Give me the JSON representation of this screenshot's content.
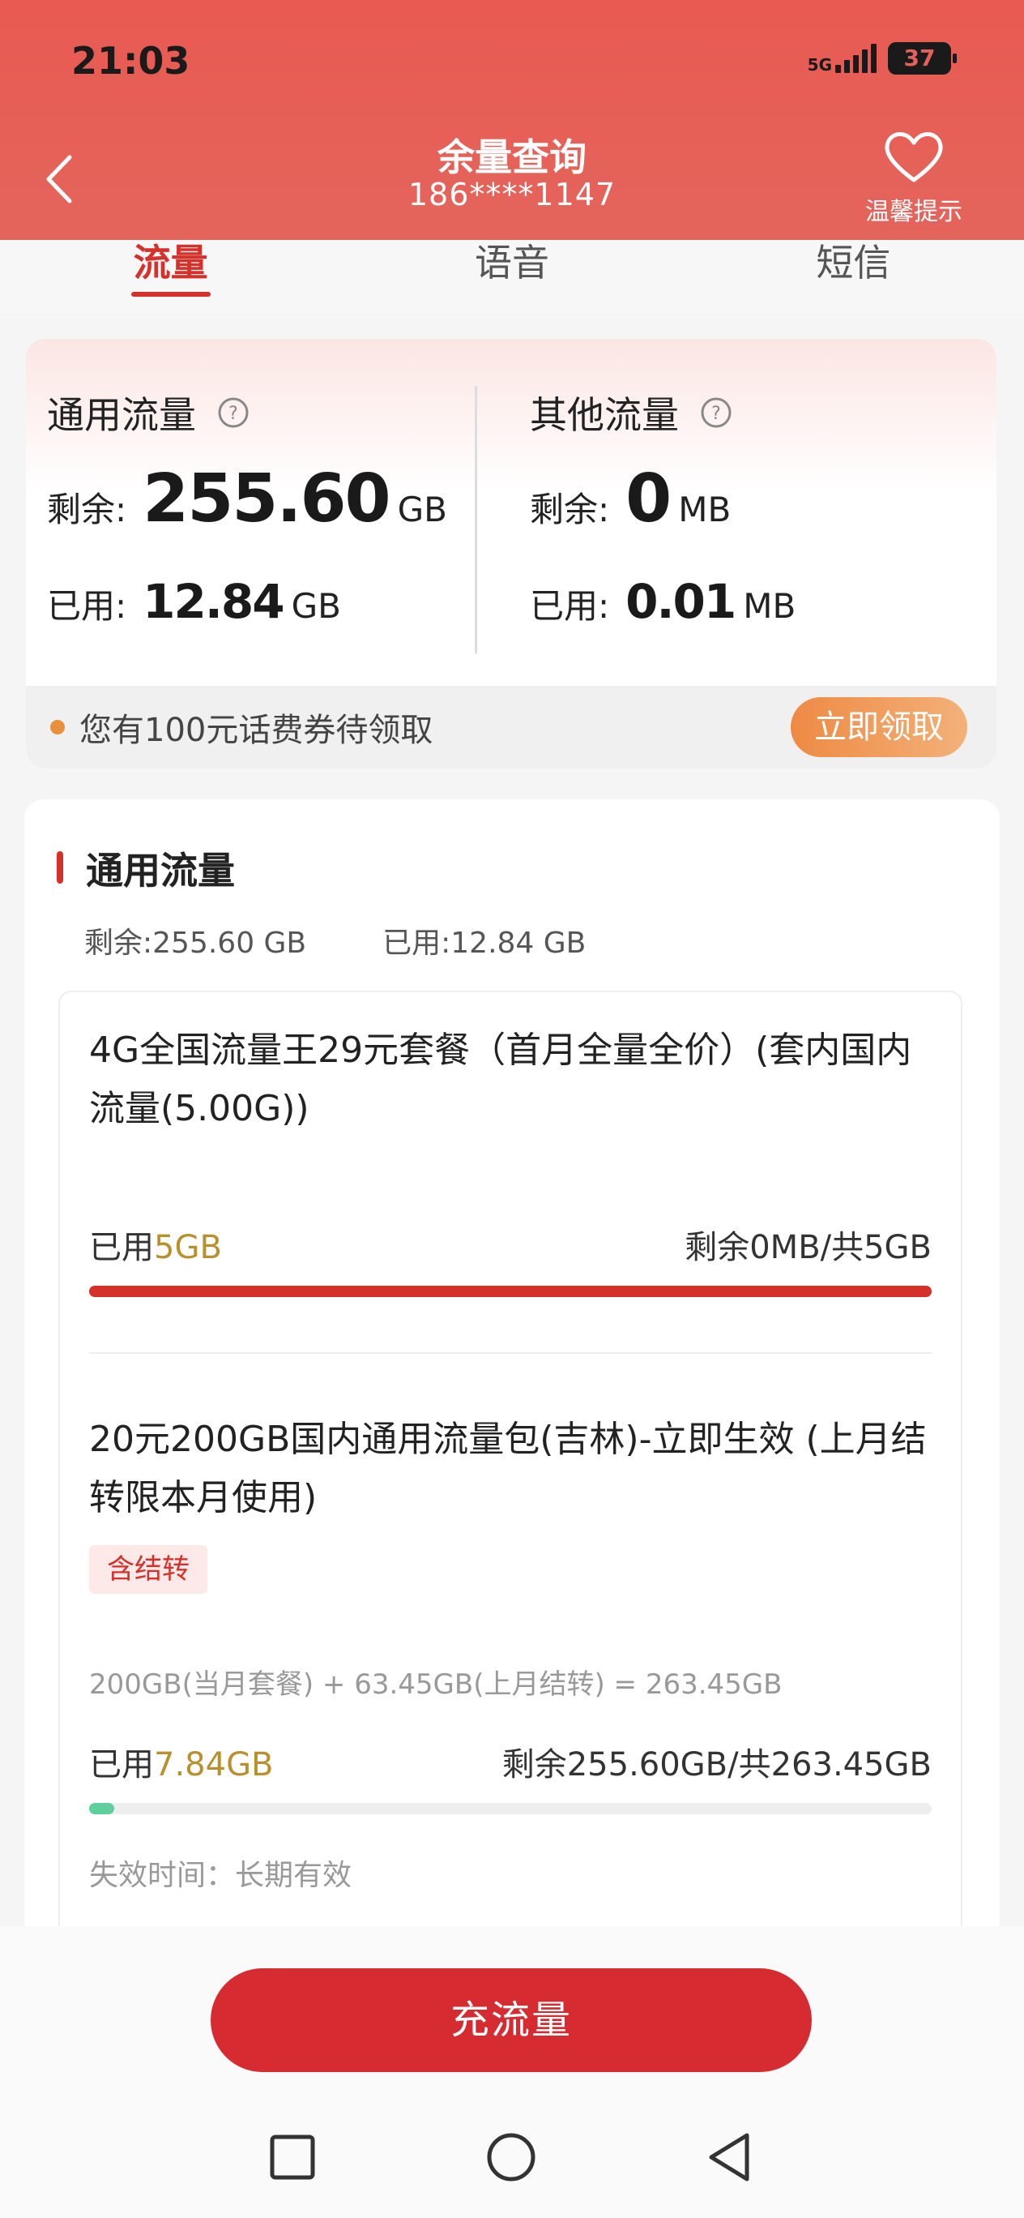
{
  "status_bar": {
    "time": "21:03",
    "network": "5G",
    "battery": "37"
  },
  "header": {
    "title": "余量查询",
    "phone": "186****1147",
    "tip_label": "温馨提示"
  },
  "tabs": [
    {
      "label": "流量",
      "active": true
    },
    {
      "label": "语音",
      "active": false
    },
    {
      "label": "短信",
      "active": false
    }
  ],
  "summary": {
    "general": {
      "title": "通用流量",
      "remain_label": "剩余:",
      "remain_value": "255.60",
      "remain_unit": "GB",
      "used_label": "已用:",
      "used_value": "12.84",
      "used_unit": "GB"
    },
    "other": {
      "title": "其他流量",
      "remain_label": "剩余:",
      "remain_value": "0",
      "remain_unit": "MB",
      "used_label": "已用:",
      "used_value": "0.01",
      "used_unit": "MB"
    }
  },
  "coupon": {
    "text": "您有100元话费券待领取",
    "button": "立即领取"
  },
  "detail": {
    "title": "通用流量",
    "remain": "剩余:255.60 GB",
    "used": "已用:12.84 GB",
    "packages": [
      {
        "name": "4G全国流量王29元套餐（首月全量全价）(套内国内流量(5.00G))",
        "used_label": "已用",
        "used_value": "5GB",
        "remaining": "剩余0MB/共5GB",
        "progress": 1.0,
        "bar_color": "#d6302b"
      },
      {
        "name": "20元200GB国内通用流量包(吉林)-立即生效 (上月结转限本月使用)",
        "badge": "含结转",
        "formula": "200GB(当月套餐) + 63.45GB(上月结转) = 263.45GB",
        "used_label": "已用",
        "used_value": "7.84GB",
        "remaining": "剩余255.60GB/共263.45GB",
        "progress": 0.0298,
        "bar_color": "#5fcf9d",
        "expire": "失效时间：长期有效"
      }
    ]
  },
  "bottom_button": "充流量",
  "colors": {
    "accent": "#d6302b",
    "header": "#e85a52",
    "gold": "#b8902c",
    "orange": "#ee8a45"
  }
}
